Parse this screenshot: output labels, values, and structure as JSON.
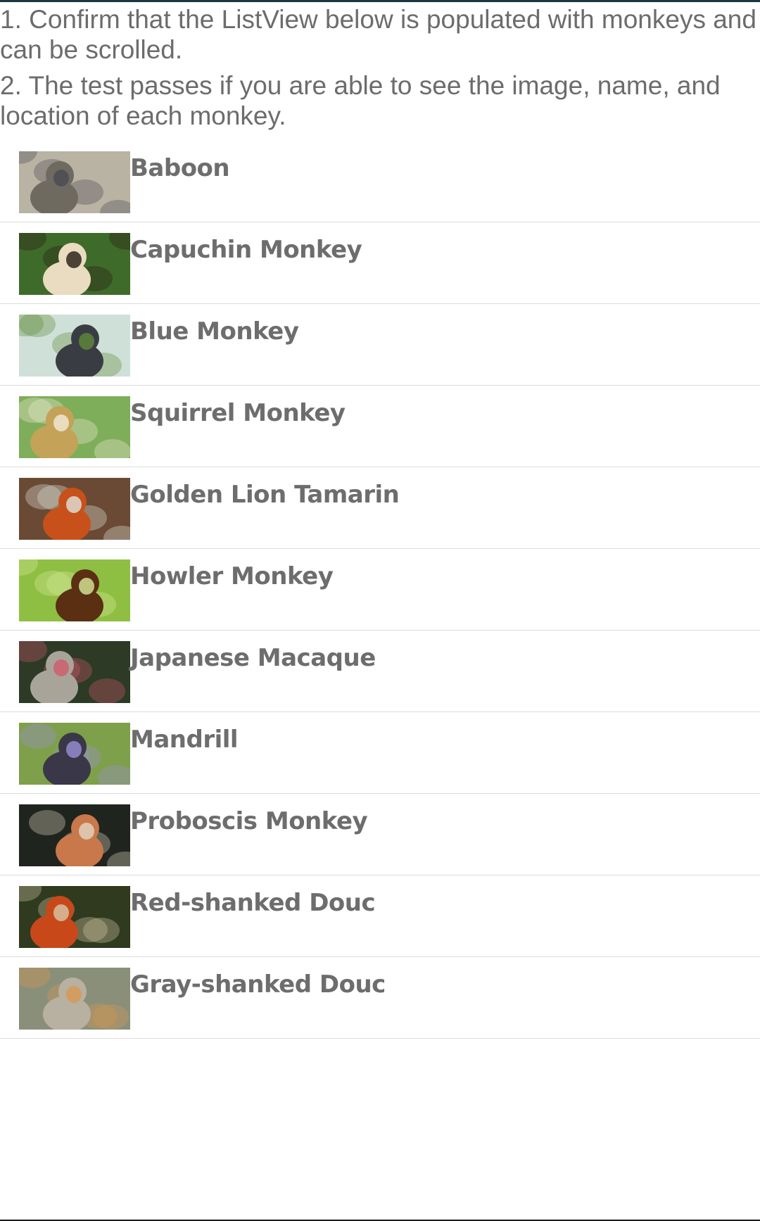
{
  "instructions": [
    "1. Confirm that the ListView below is populated with monkeys and can be scrolled.",
    "2. The test passes if you are able to see the image, name, and location of each monkey."
  ],
  "monkeys": [
    {
      "name": "Baboon",
      "image_icon": "baboon-photo",
      "bg": "#b9b3a3",
      "fg": "#6f6a60",
      "accent": "#4a4a52"
    },
    {
      "name": "Capuchin Monkey",
      "image_icon": "capuchin-monkey-photo",
      "bg": "#3f6b2a",
      "fg": "#e9dcc0",
      "accent": "#241a12"
    },
    {
      "name": "Blue Monkey",
      "image_icon": "blue-monkey-photo",
      "bg": "#cfe0d8",
      "fg": "#3a3c44",
      "accent": "#5f8a3a"
    },
    {
      "name": "Squirrel Monkey",
      "image_icon": "squirrel-monkey-photo",
      "bg": "#7fae5a",
      "fg": "#c4a258",
      "accent": "#f1ecd8"
    },
    {
      "name": "Golden Lion Tamarin",
      "image_icon": "golden-lion-tamarin-photo",
      "bg": "#6a4a34",
      "fg": "#c8501a",
      "accent": "#e0e4dc"
    },
    {
      "name": "Howler Monkey",
      "image_icon": "howler-monkey-photo",
      "bg": "#8fbf42",
      "fg": "#5a2f12",
      "accent": "#d8ea9a"
    },
    {
      "name": "Japanese Macaque",
      "image_icon": "japanese-macaque-photo",
      "bg": "#2c3a26",
      "fg": "#a9a49a",
      "accent": "#d05a6a"
    },
    {
      "name": "Mandrill",
      "image_icon": "mandrill-photo",
      "bg": "#7ea04a",
      "fg": "#3a3848",
      "accent": "#9a90d8"
    },
    {
      "name": "Proboscis Monkey",
      "image_icon": "proboscis-monkey-photo",
      "bg": "#20241e",
      "fg": "#c8784a",
      "accent": "#e2d6c2"
    },
    {
      "name": "Red-shanked Douc",
      "image_icon": "red-shanked-douc-photo",
      "bg": "#2f3a1e",
      "fg": "#c8481a",
      "accent": "#d8c8a8"
    },
    {
      "name": "Gray-shanked Douc",
      "image_icon": "gray-shanked-douc-photo",
      "bg": "#8a8f7a",
      "fg": "#b8b0a0",
      "accent": "#d89850"
    }
  ]
}
